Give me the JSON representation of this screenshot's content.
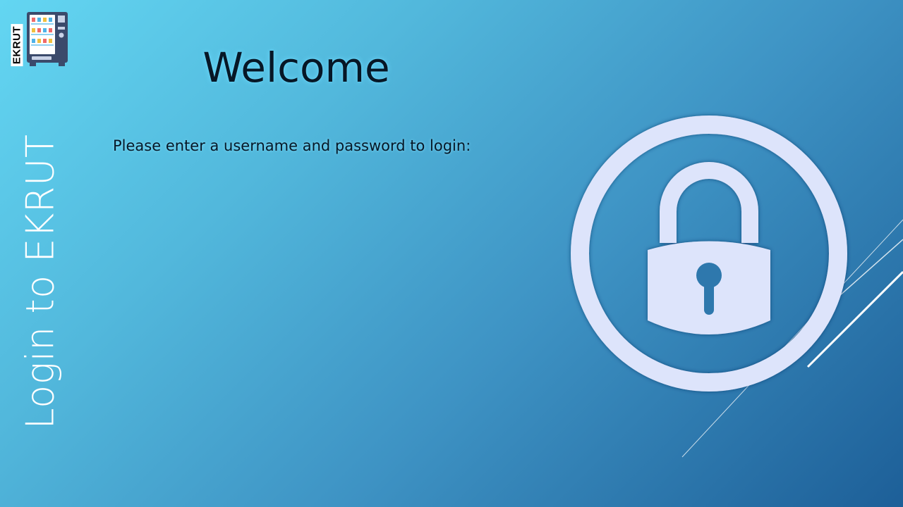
{
  "app": {
    "logo_text": "EKRUT"
  },
  "sidebar": {
    "vertical_title": "Login to EKRUT"
  },
  "main": {
    "welcome": "Welcome",
    "instruction": "Please enter a username and password to login:"
  },
  "icons": {
    "logo": "vending-machine-icon",
    "lock": "padlock-icon"
  },
  "colors": {
    "background_start": "#63d6f2",
    "background_end": "#1d5f98",
    "lock_fill": "#dde4fb"
  }
}
